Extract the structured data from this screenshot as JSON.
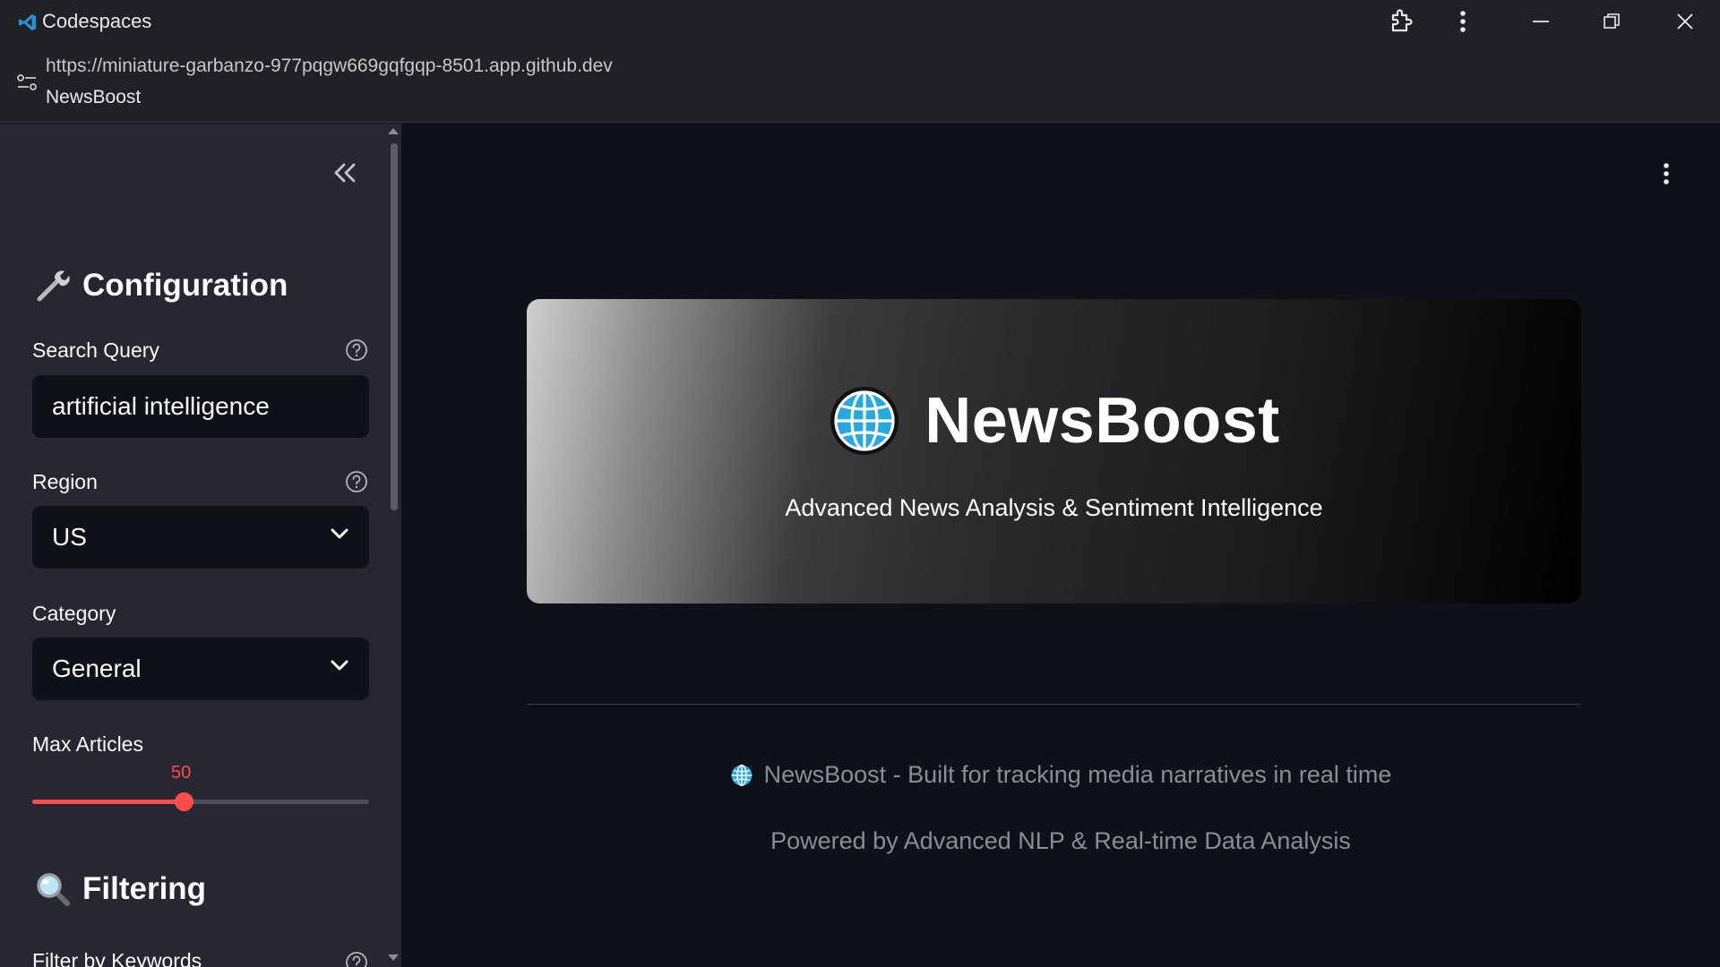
{
  "window": {
    "title": "Codespaces",
    "app_icon": "vscode-icon",
    "buttons": [
      "extension-icon",
      "more-vert-icon",
      "minimize-icon",
      "restore-icon",
      "close-icon"
    ]
  },
  "address": {
    "url": "https://miniature-garbanzo-977pqgw669gqfgqp-8501.app.github.dev",
    "page_title": "NewsBoost",
    "site_icon": "site-settings-icon"
  },
  "sidebar": {
    "collapse_icon": "double-chevron-left-icon",
    "configuration": {
      "heading": "Configuration",
      "icon": "wrench-icon"
    },
    "search_query": {
      "label": "Search Query",
      "value": "artificial intelligence"
    },
    "region": {
      "label": "Region",
      "value": "US"
    },
    "category": {
      "label": "Category",
      "value": "General"
    },
    "max_articles": {
      "label": "Max Articles",
      "value": "50",
      "fraction": 0.45
    },
    "filtering": {
      "heading": "Filtering",
      "icon": "magnifying-glass-icon"
    },
    "filter_keywords": {
      "label": "Filter by Keywords"
    }
  },
  "main": {
    "hero": {
      "title": "NewsBoost",
      "subtitle": "Advanced News Analysis & Sentiment Intelligence",
      "icon": "globe-icon"
    },
    "footer": {
      "line1": "NewsBoost - Built for tracking media narratives in real time",
      "line2": "Powered by Advanced NLP & Real-time Data Analysis"
    }
  },
  "colors": {
    "accent": "#ff4b4b",
    "sidebar_bg": "#262730",
    "main_bg": "#0e1117",
    "titlebar_bg": "#202124",
    "globe_blue": "#29a8e0"
  }
}
